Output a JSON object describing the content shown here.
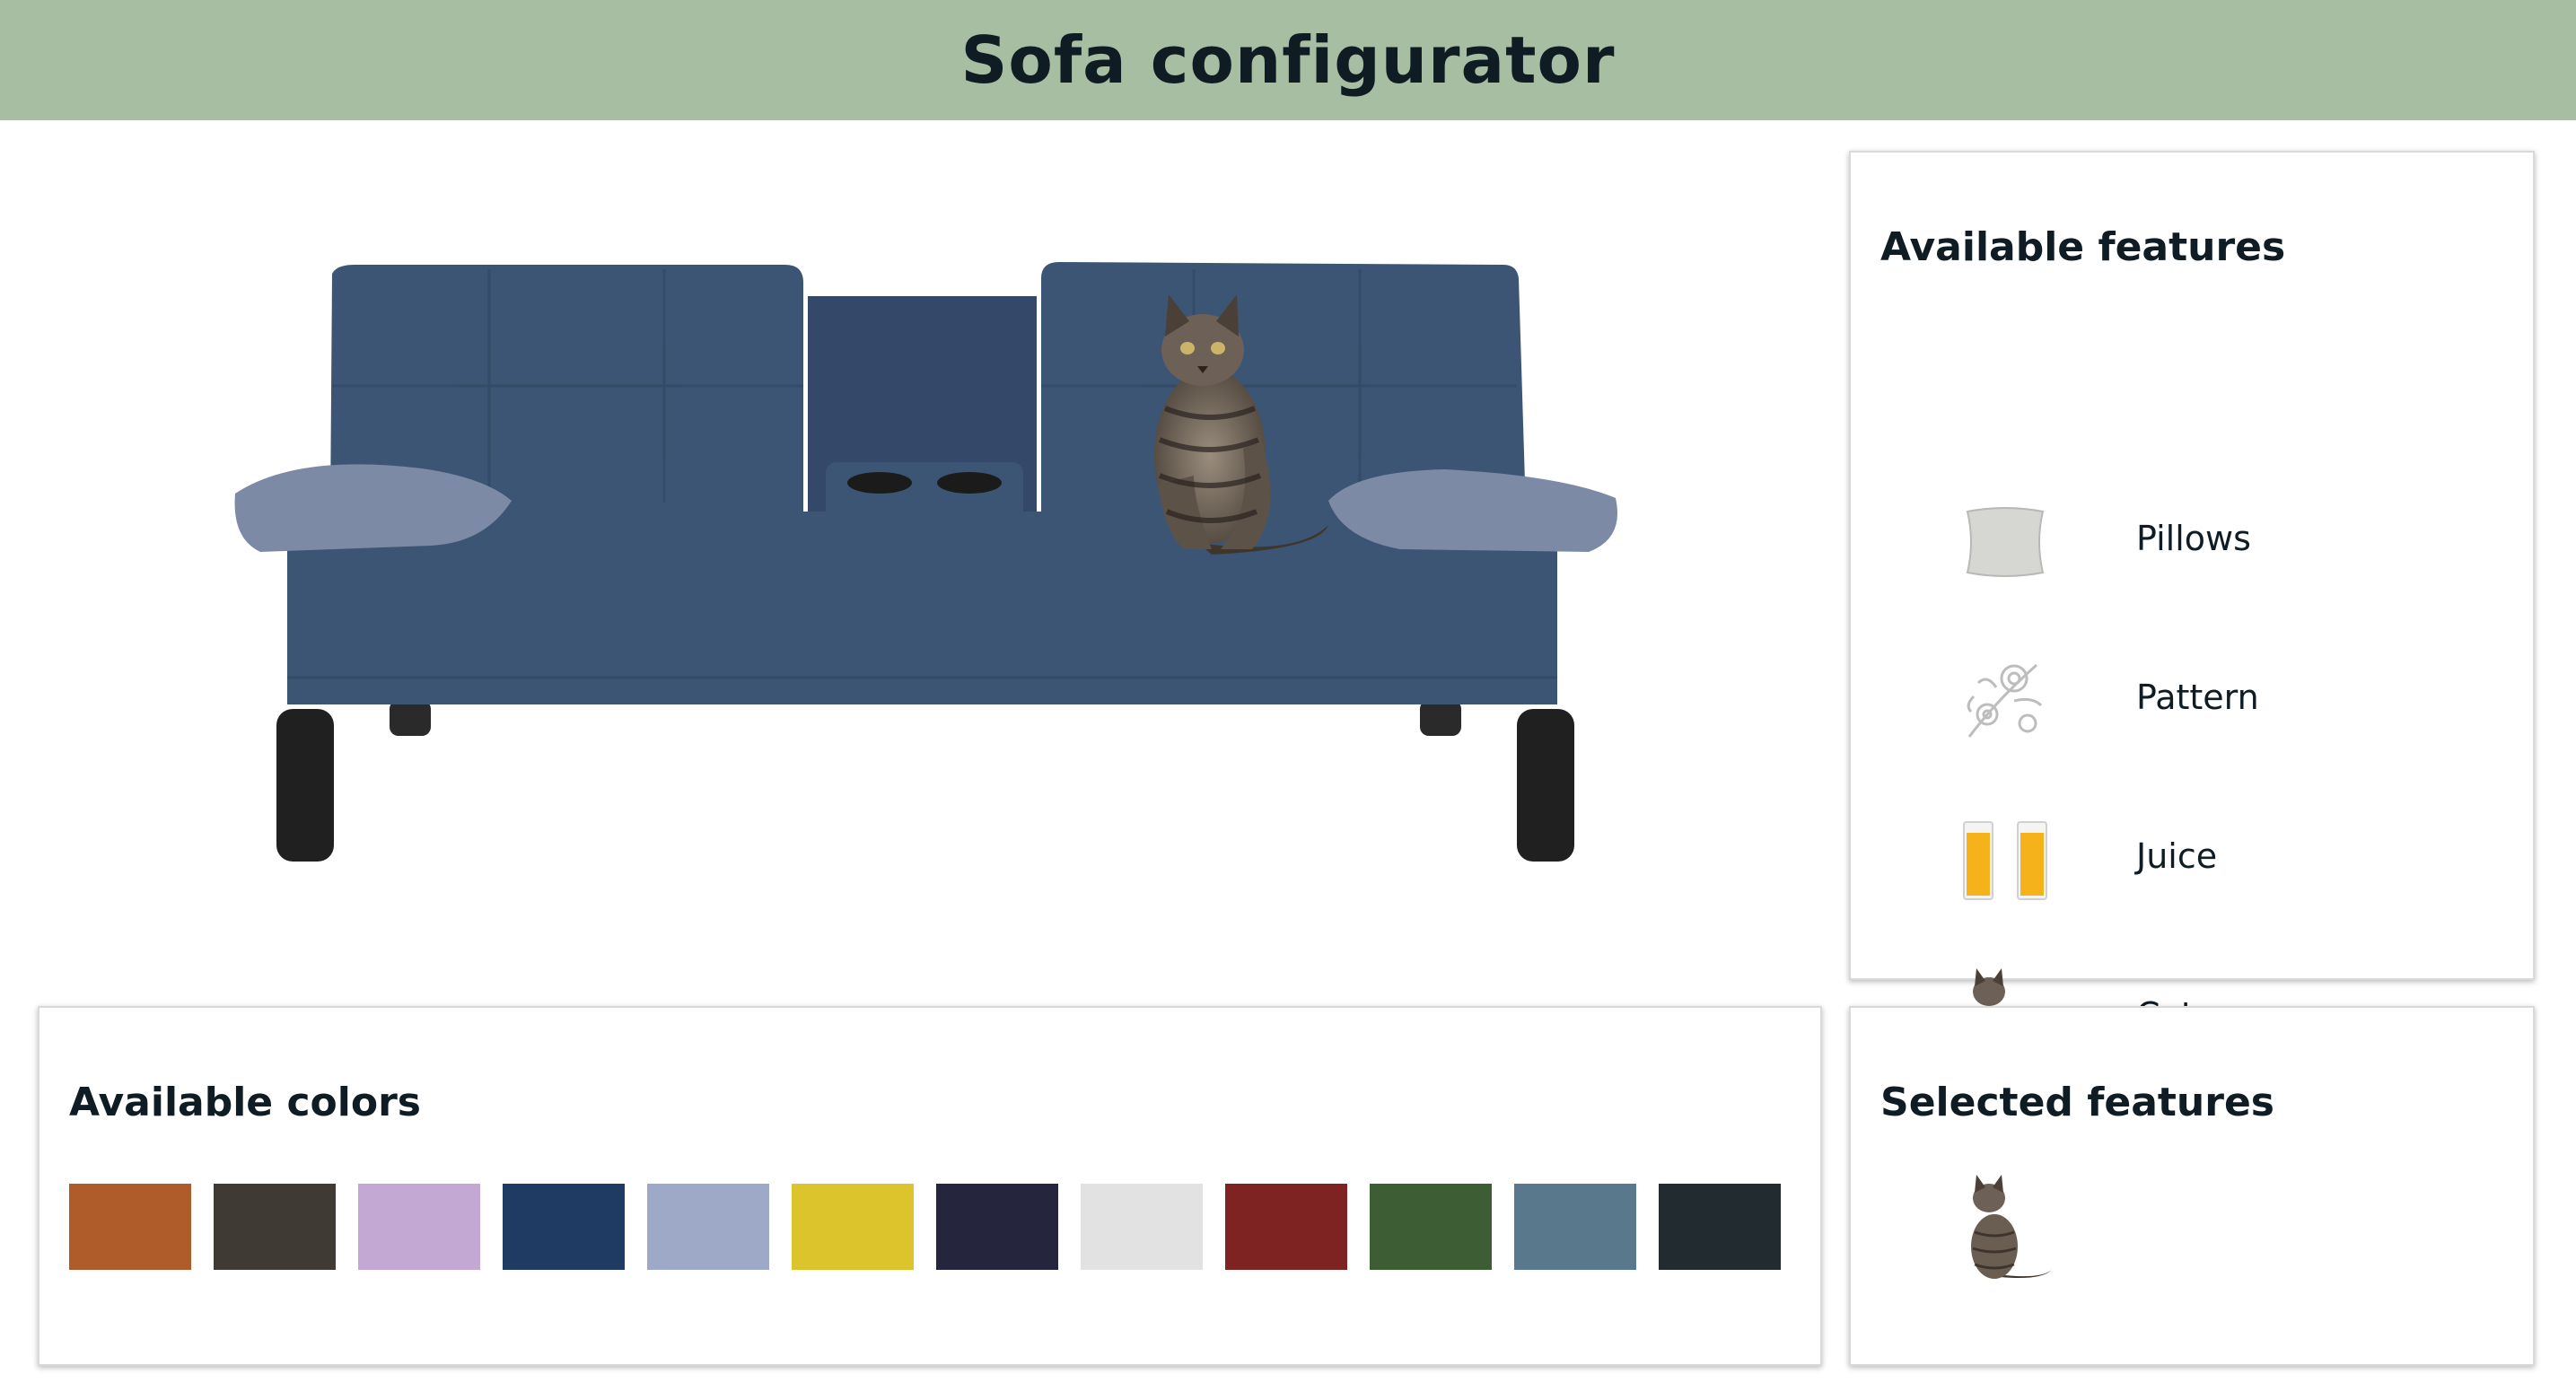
{
  "header": {
    "title": "Sofa configurator"
  },
  "preview": {
    "sofa_color": "#3c5575",
    "pillow_color": "#7c8aa6",
    "features_shown": [
      "pillows",
      "cat"
    ]
  },
  "features": {
    "title": "Available features",
    "items": [
      {
        "label": "Pillows",
        "icon": "pillow-icon",
        "selected": false
      },
      {
        "label": "Pattern",
        "icon": "floral-pattern-icon",
        "selected": false
      },
      {
        "label": "Juice",
        "icon": "juice-glasses-icon",
        "selected": false
      },
      {
        "label": "Cat",
        "icon": "cat-icon",
        "selected": true
      }
    ]
  },
  "colors": {
    "title": "Available colors",
    "swatches": [
      "#b05c2a",
      "#403a35",
      "#c2a8d3",
      "#203b63",
      "#9ea8c7",
      "#dcc42c",
      "#25253e",
      "#e2e2e2",
      "#7e2222",
      "#3d5e35",
      "#5a788c",
      "#222c30"
    ]
  },
  "selected": {
    "title": "Selected features",
    "items": [
      {
        "label": "Cat",
        "icon": "cat-icon"
      }
    ]
  }
}
